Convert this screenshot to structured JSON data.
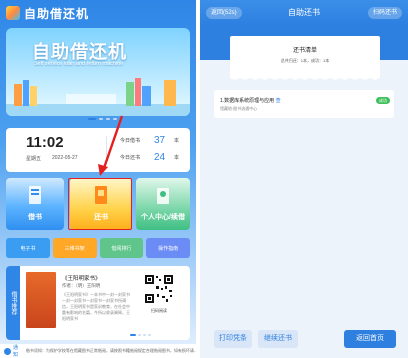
{
  "left": {
    "app_title": "自助借还机",
    "banner": {
      "title": "自助借还机",
      "subtitle": "Self service loan and return machine"
    },
    "clock": {
      "time": "11:02",
      "weekday": "星期五",
      "date": "2022-05-27"
    },
    "stats": [
      {
        "label": "今日借书",
        "value": "37",
        "unit": "本"
      },
      {
        "label": "今日还书",
        "value": "24",
        "unit": "本"
      }
    ],
    "tiles": [
      {
        "label": "借书"
      },
      {
        "label": "还书"
      },
      {
        "label": "个人中心/续借"
      }
    ],
    "mini_buttons": [
      {
        "label": "电子书",
        "color": "#3a9df2"
      },
      {
        "label": "三维书架",
        "color": "#ffa726"
      },
      {
        "label": "借阅排行",
        "color": "#5fc58a"
      },
      {
        "label": "操作指南",
        "color": "#6c8cf5"
      }
    ],
    "recommend": {
      "side_label": "借书推荐",
      "book_title": "《王阳明家书》",
      "author": "作者：（明）王阳明",
      "description": "《王阳明家书》一本书中一封一封家书一封一封家书一封家书一封家书所谓信，王阳明家书是家训教育，在社会中重有影响的名篇，今所以收录阐释。王阳明家书",
      "qr_label": "扫码阅读"
    },
    "notice": {
      "label": "通知",
      "text": "借书须知：为保护学校等在馆藏图书正常借阅，请按照书籍借阅规定合理借阅图书，如有损坏请..."
    }
  },
  "right": {
    "back_label": "返回(52s)",
    "title": "自助还书",
    "scan_label": "扫码还书",
    "receipt": {
      "title": "还书清单",
      "summary": "总共归还：1本，成功：1本"
    },
    "items": [
      {
        "name": "1.数据库系统原理与应用",
        "tag": "查",
        "sub": "馆藏地:图书流通中心",
        "status": "成功"
      }
    ],
    "buttons": {
      "print": "打印凭条",
      "continue": "继续还书",
      "home": "返回首页"
    }
  }
}
